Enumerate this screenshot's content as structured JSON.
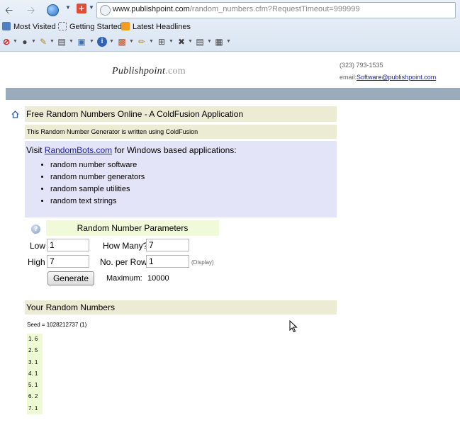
{
  "browser": {
    "url_domain": "www.publishpoint.com",
    "url_path": "/random_numbers.cfm?RequestTimeout=999999",
    "bookmarks": [
      {
        "label": "Most Visited",
        "icon": "most-visited-icon"
      },
      {
        "label": "Getting Started",
        "icon": "page-icon"
      },
      {
        "label": "Latest Headlines",
        "icon": "rss-icon"
      }
    ]
  },
  "header": {
    "logo_main": "Publishpoint",
    "logo_domain": ".com",
    "phone": "(323) 793-1535",
    "email_label": "email:",
    "email_address": "Software@publishpoint.com"
  },
  "main": {
    "title": "Free Random Numbers Online - A ColdFusion Application",
    "subtitle": "This Random Number Generator is written using ColdFusion",
    "visit_prefix": "Visit",
    "visit_link": "RandomBots.com",
    "visit_suffix": "for Windows based applications:",
    "visit_items": [
      "random number software",
      "random number generators",
      "random sample utilities",
      "random text strings"
    ]
  },
  "params": {
    "heading": "Random Number Parameters",
    "low_label": "Low",
    "low_value": "1",
    "high_label": "High",
    "high_value": "7",
    "how_many_label": "How Many?",
    "how_many_value": "7",
    "per_row_label": "No. per Row",
    "per_row_value": "1",
    "display_note": "(Display)",
    "generate_label": "Generate",
    "maximum_label": "Maximum:",
    "maximum_value": "10000"
  },
  "results": {
    "heading": "Your Random Numbers",
    "seed_text": "Seed = 1028212737   (1)",
    "items": [
      "1. 6",
      "2. 5",
      "3. 1",
      "4. 1",
      "5. 1",
      "6. 2",
      "7. 1"
    ]
  },
  "colors": {
    "section_band": "#ecebd4",
    "visit_band": "#e4e4f8",
    "params_band": "#f0fad8",
    "header_bar": "#9aacbb",
    "link": "#1a1aa6"
  }
}
